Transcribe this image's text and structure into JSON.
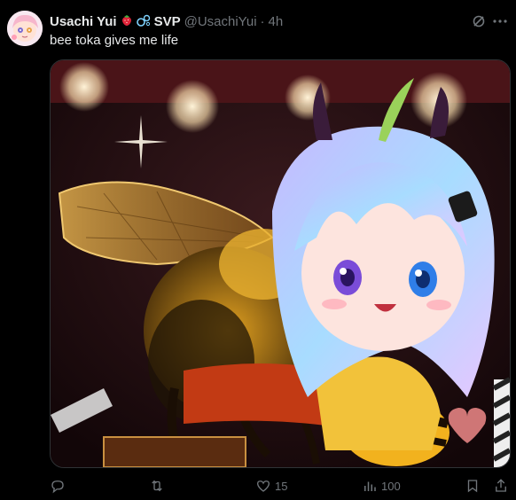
{
  "post": {
    "author_name": "Usachi Yui",
    "author_badges": [
      "strawberry-emoji",
      "bubbles-emoji"
    ],
    "author_tag": "SVP",
    "handle": "@UsachiYui",
    "separator": "·",
    "time": "4h",
    "text": "bee toka gives me life"
  },
  "actions": {
    "replies": "",
    "reposts": "",
    "likes": "15",
    "views": "100"
  },
  "colors": {
    "background": "#000000",
    "text_primary": "#e7e9ea",
    "text_secondary": "#71767b"
  }
}
